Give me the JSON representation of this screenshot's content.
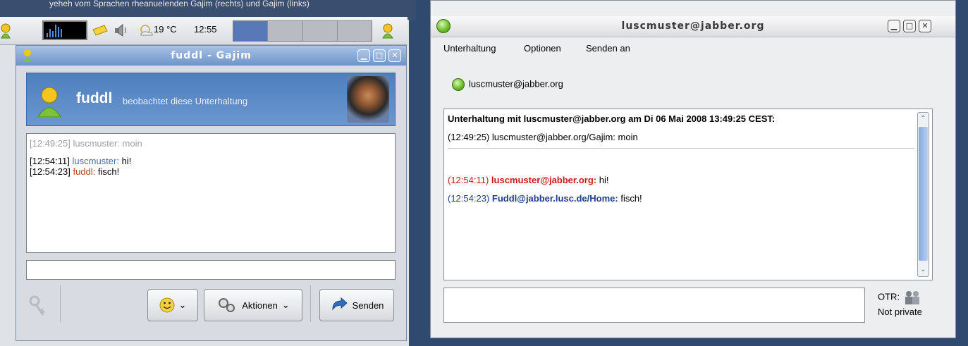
{
  "top_strip_caption": "yeheh vom Sprachen rheanuelenden Gajim (rechts) und Gajim (links)",
  "panel": {
    "temperature": "19 °C",
    "clock": "12:55",
    "monitor_bars": [
      2,
      4,
      3,
      6,
      5,
      4
    ]
  },
  "left_window": {
    "title": "fuddl - Gajim",
    "banner": {
      "name": "fuddl",
      "status": "beobachtet diese Unterhaltung"
    },
    "messages": [
      {
        "time": "[12:49:25]",
        "nick": "luscmuster:",
        "text": " moin",
        "style": "gray"
      },
      {
        "time": "[12:54:11]",
        "nick": "luscmuster:",
        "text": " hi!",
        "style": "normal"
      },
      {
        "time": "[12:54:23]",
        "nick": "fuddl:",
        "text": " fisch!",
        "style": "own"
      }
    ],
    "buttons": {
      "actions": "Aktionen",
      "send": "Senden"
    }
  },
  "right_window": {
    "title": "luscmuster@jabber.org",
    "menu": [
      "Unterhaltung",
      "Optionen",
      "Senden an"
    ],
    "contact": "luscmuster@jabber.org",
    "history_header": "Unterhaltung mit luscmuster@jabber.org am Di 06 Mai 2008 13:49:25 CEST:",
    "history_line": "(12:49:25) luscmuster@jabber.org/Gajim: moin",
    "messages": [
      {
        "time": "(12:54:11)",
        "nick": "luscmuster@jabber.org:",
        "text": " hi!",
        "color": "#cc1a1a"
      },
      {
        "time": "(12:54:23)",
        "nick": "Fuddl@jabber.lusc.de/Home:",
        "text": " fisch!",
        "color": "#1f3f8a"
      }
    ],
    "otr_label": "OTR:",
    "otr_status": "Not private"
  }
}
